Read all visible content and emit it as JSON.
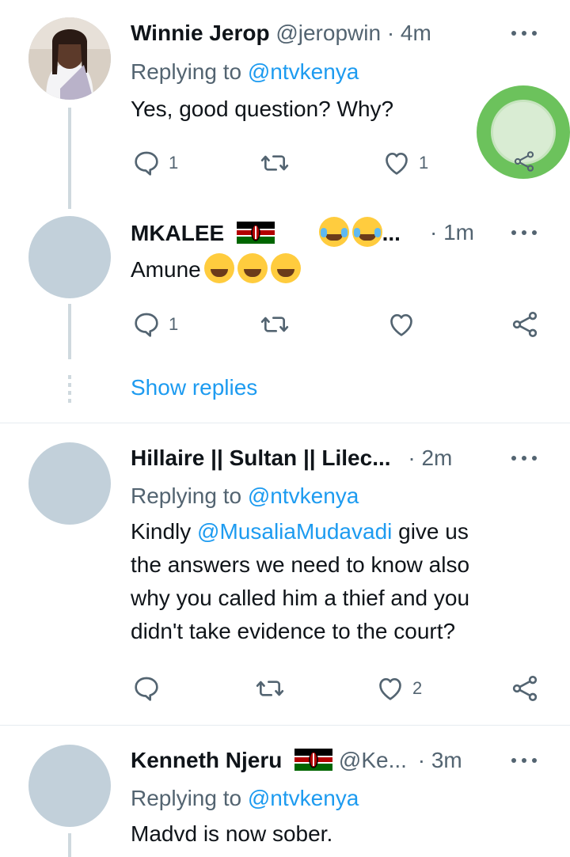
{
  "tweets": [
    {
      "name": "Winnie Jerop",
      "handle": "@jeropwin",
      "dot": "·",
      "time": "4m",
      "replying_prefix": "Replying to ",
      "replying_handle": "@ntvkenya",
      "text": "Yes, good question? Why?",
      "replies": "1",
      "retweets": "",
      "likes": "1"
    },
    {
      "name": "MKALEE",
      "ellipsis": "...",
      "dot": "·",
      "time": "1m",
      "text": "Amune",
      "replies": "1",
      "retweets": "",
      "likes": ""
    },
    {
      "name": "Hillaire || Sultan || Lilec...",
      "dot": "·",
      "time": "2m",
      "replying_prefix": "Replying to ",
      "replying_handle": "@ntvkenya",
      "text_prefix": "Kindly ",
      "text_mention": "@MusaliaMudavadi",
      "text_rest1": " give us",
      "text_line2": "the answers we need to know also",
      "text_line3": "why you called him a thief and you",
      "text_line4": "didn't take evidence to the court?",
      "replies": "",
      "retweets": "",
      "likes": "2"
    },
    {
      "name": "Kenneth Njeru",
      "handle": "@Ke...",
      "dot": "·",
      "time": "3m",
      "replying_prefix": "Replying to ",
      "replying_handle": "@ntvkenya",
      "text": "Madvd is now sober."
    }
  ],
  "show_replies": "Show replies",
  "icons": {
    "reply": "reply-bubble-icon",
    "retweet": "retweet-icon",
    "like": "heart-icon",
    "share": "share-icon",
    "more": "more-dots-icon"
  },
  "colors": {
    "link": "#1d9bf0",
    "secondary_text": "#536471",
    "avatar_placeholder": "#c2d0da",
    "floating_button": "#6cc25c"
  }
}
